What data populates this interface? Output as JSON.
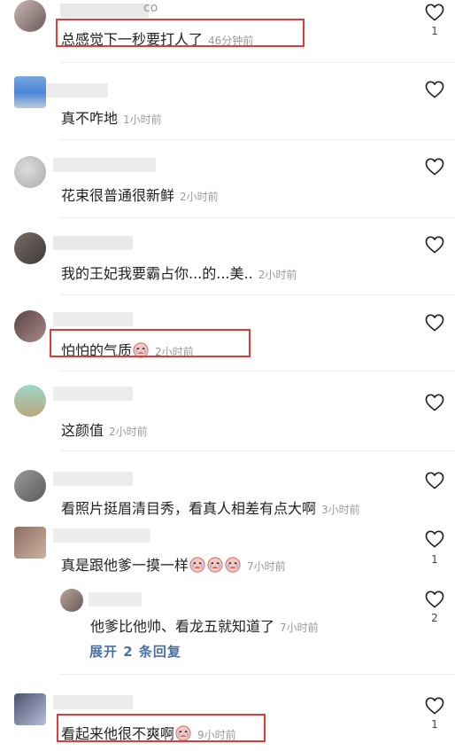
{
  "comments": [
    {
      "text": "总感觉下一秒要打人了",
      "time": "46分钟前",
      "likes": "1",
      "name_fragment": "co"
    },
    {
      "text": "真不咋地",
      "time": "1小时前",
      "likes": ""
    },
    {
      "text": "花束很普通很新鲜",
      "time": "2小时前",
      "likes": ""
    },
    {
      "text": "我的王妃我要霸占你...的...美..",
      "time": "2小时前",
      "likes": ""
    },
    {
      "text": "怕怕的气质",
      "time": "2小时前",
      "likes": ""
    },
    {
      "text": "这颜值",
      "time": "2小时前",
      "likes": ""
    },
    {
      "text": "看照片挺眉清目秀，看真人相差有点大啊",
      "time": "3小时前",
      "likes": ""
    },
    {
      "text": "真是跟他爹一摸一样",
      "time": "7小时前",
      "likes": "1"
    },
    {
      "text": "他爹比他帅、看龙五就知道了",
      "time": "7小时前",
      "likes": "2"
    },
    {
      "text": "看起来他很不爽啊",
      "time": "9小时前",
      "likes": "1"
    }
  ],
  "expand_replies": "展开 2 条回复",
  "colors": {
    "highlight_box": "#e53935",
    "link": "#4a6fa5",
    "time": "#9a9a9a"
  },
  "icons": [
    "heart-outline-icon",
    "crying-emoji-icon"
  ]
}
